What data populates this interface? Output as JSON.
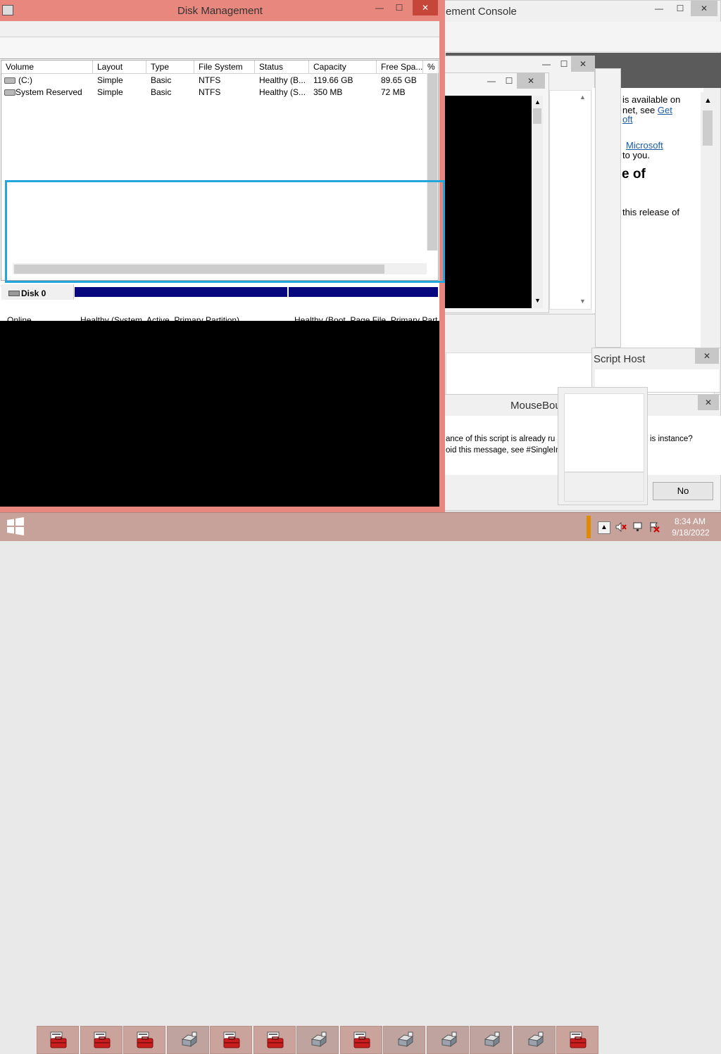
{
  "mmc": {
    "title": "Computer Management Console",
    "title_visible": "ement Console",
    "minimize": "—",
    "maximize": "☐",
    "close": "✕",
    "help": {
      "line1": "is available on",
      "line2a": "net, see ",
      "link1": "Get",
      "link2": "oft",
      "line3a": "",
      "link3": "Microsoft",
      "line4": "to you.",
      "heading": "e of",
      "line5": "this release of"
    }
  },
  "child1": {
    "minimize": "—",
    "maximize": "☐",
    "close": "✕"
  },
  "child2": {
    "minimize": "—",
    "maximize": "☐",
    "close": "✕"
  },
  "wsh": {
    "title": "Script Host",
    "close": "✕"
  },
  "mouse_bound": {
    "title": "MouseBou",
    "msg1": "ance of this script is already ru",
    "msg1b": "is instance?",
    "msg2": "oid this message, see #SingleIns",
    "no_button": "No",
    "close": "✕"
  },
  "disk_mgmt": {
    "title": "Disk Management",
    "minimize": "—",
    "maximize": "☐",
    "close": "✕",
    "columns": [
      "Volume",
      "Layout",
      "Type",
      "File System",
      "Status",
      "Capacity",
      "Free Spa...",
      "% F"
    ],
    "rows": [
      {
        "volume": "(C:)",
        "layout": "Simple",
        "type": "Basic",
        "fs": "NTFS",
        "status": "Healthy (B...",
        "capacity": "119.66 GB",
        "free": "89.65 GB"
      },
      {
        "volume": "System Reserved",
        "layout": "Simple",
        "type": "Basic",
        "fs": "NTFS",
        "status": "Healthy (S...",
        "capacity": "350 MB",
        "free": "72 MB"
      }
    ],
    "disk0_label": "Disk 0",
    "disk0_state": "Online",
    "part1_status": "Healthy (System, Active, Primary Partition)",
    "part2_status": "Healthy (Boot, Page File, Primary Partition)"
  },
  "taskbar": {
    "start": "start-icon",
    "clock_time": "8:34 AM",
    "clock_date": "9/18/2022",
    "tray_expand": "▲",
    "items": [
      "toolbox",
      "toolbox",
      "toolbox",
      "drive",
      "toolbox",
      "toolbox",
      "drive",
      "toolbox",
      "drive",
      "drive",
      "drive",
      "drive",
      "toolbox"
    ]
  },
  "colors": {
    "disk_bar": "#08087e",
    "focus_rect": "#22a6dc",
    "active_border": "#e8877d"
  }
}
